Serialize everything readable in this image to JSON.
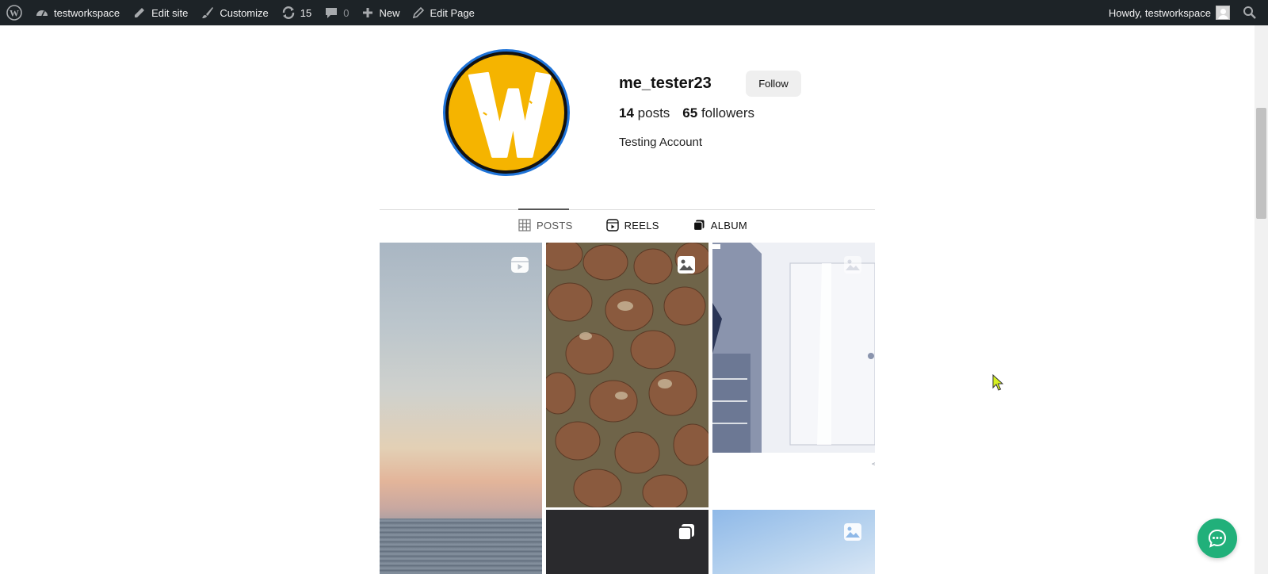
{
  "adminbar": {
    "site_name": "testworkspace",
    "edit_site": "Edit site",
    "customize": "Customize",
    "updates_count": "15",
    "comments_count": "0",
    "new": "New",
    "edit_page": "Edit Page",
    "howdy": "Howdy, testworkspace"
  },
  "profile": {
    "username": "me_tester23",
    "follow_label": "Follow",
    "posts_count": "14",
    "posts_label": "posts",
    "followers_count": "65",
    "followers_label": "followers",
    "bio": "Testing Account"
  },
  "tabs": [
    {
      "label": "POSTS",
      "icon": "grid-icon",
      "active": true
    },
    {
      "label": "REELS",
      "icon": "reels-icon",
      "active": false
    },
    {
      "label": "ALBUM",
      "icon": "album-icon",
      "active": false
    }
  ],
  "grid": [
    {
      "type": "reel",
      "icon": "reel-icon",
      "subject": "sunset-over-sea"
    },
    {
      "type": "image",
      "icon": "image-icon",
      "subject": "mushrooms"
    },
    {
      "type": "image",
      "icon": "image-icon",
      "subject": "ui-mockup"
    },
    {
      "type": "album",
      "icon": "album-icon",
      "subject": "dark"
    },
    {
      "type": "image",
      "icon": "image-icon",
      "subject": "sky"
    }
  ],
  "colors": {
    "adminbar_bg": "#1d2327",
    "avatar_yellow": "#f5b400",
    "avatar_ring": "#1e73d8",
    "chat_green": "#21b07a"
  }
}
